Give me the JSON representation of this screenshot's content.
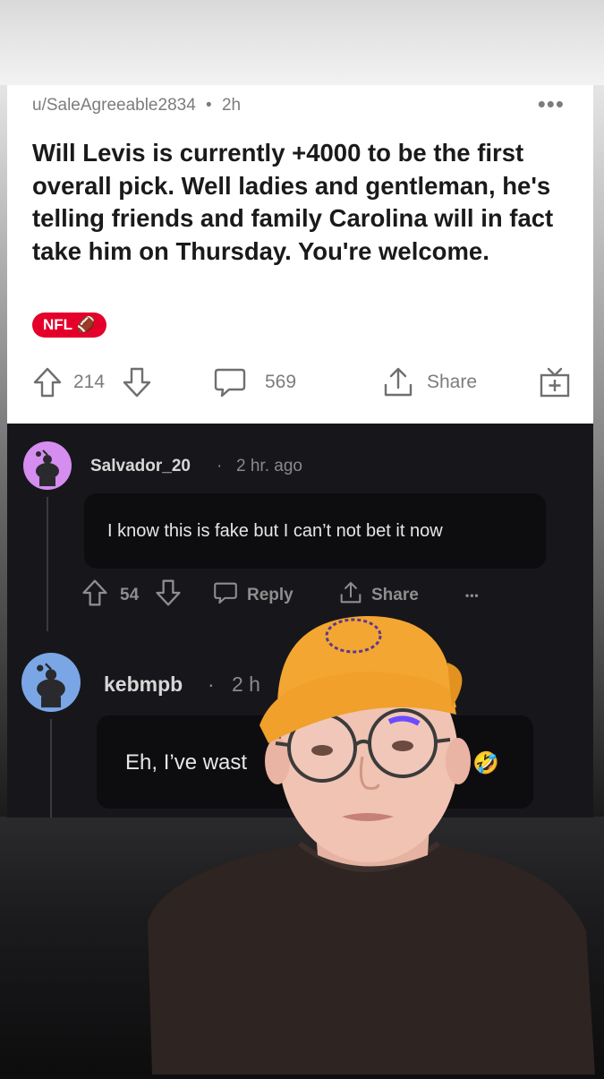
{
  "post": {
    "username": "u/SaleAgreeable2834",
    "separator": "•",
    "age": "2h",
    "more": "•••",
    "title": "Will Levis is currently +4000 to be the first overall pick. Well ladies and gentleman, he's telling friends and family Carolina will in fact take him on Thursday. You're welcome.",
    "flair": "NFL 🏈",
    "votes": "214",
    "comments_count": "569",
    "share_label": "Share"
  },
  "comments": [
    {
      "user": "Salvador_20",
      "separator": "·",
      "time": "2 hr. ago",
      "body": "I know this is fake but I can’t not bet it now",
      "votes": "54",
      "reply_label": "Reply",
      "share_label": "Share",
      "more": "•••"
    },
    {
      "user": "kebmpb",
      "separator": "·",
      "time": "2 h",
      "body_left": "Eh, I’ve wast",
      "body_right": "se 🤣"
    }
  ],
  "colors": {
    "flair": "#e4002b",
    "avatar_1": "#d58df0",
    "avatar_2": "#7aa6e6",
    "cap": "#f4a632"
  }
}
